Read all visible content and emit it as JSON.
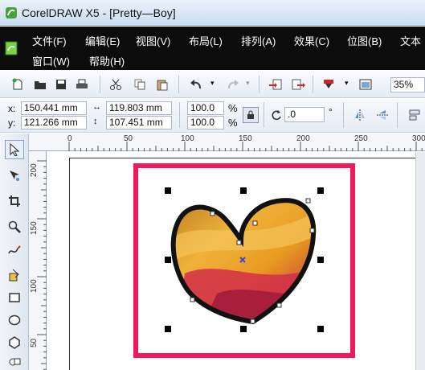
{
  "window": {
    "title": "CorelDRAW X5 - [Pretty—Boy]"
  },
  "menu": {
    "row1": [
      "文件(F)",
      "编辑(E)",
      "视图(V)",
      "布局(L)",
      "排列(A)",
      "效果(C)",
      "位图(B)",
      "文本"
    ],
    "row2": [
      "窗口(W)",
      "帮助(H)"
    ]
  },
  "toolbar": {
    "zoom_value": "35%",
    "icons": [
      "new-document-icon",
      "open-folder-icon",
      "save-icon",
      "print-icon",
      "cut-icon",
      "copy-icon",
      "paste-icon",
      "undo-icon",
      "redo-icon",
      "import-icon",
      "export-icon",
      "application-launcher-icon",
      "welcome-screen-icon"
    ]
  },
  "property_bar": {
    "x_label": "x:",
    "y_label": "y:",
    "x_value": "150.441 mm",
    "y_value": "121.266 mm",
    "width_value": "119.803 mm",
    "height_value": "107.451 mm",
    "scale_x": "100.0",
    "scale_y": "100.0",
    "percent": "%",
    "rotation_value": ".0",
    "degree": "°"
  },
  "rulers": {
    "top_ticks": [
      "0",
      "50",
      "100",
      "150",
      "200",
      "250",
      "300"
    ],
    "left_ticks": [
      "200",
      "150",
      "100",
      "50"
    ]
  },
  "colors": {
    "highlight_frame": "#f0195c",
    "menubar": "#0c0c0c",
    "selection_center": "#3349d9"
  }
}
